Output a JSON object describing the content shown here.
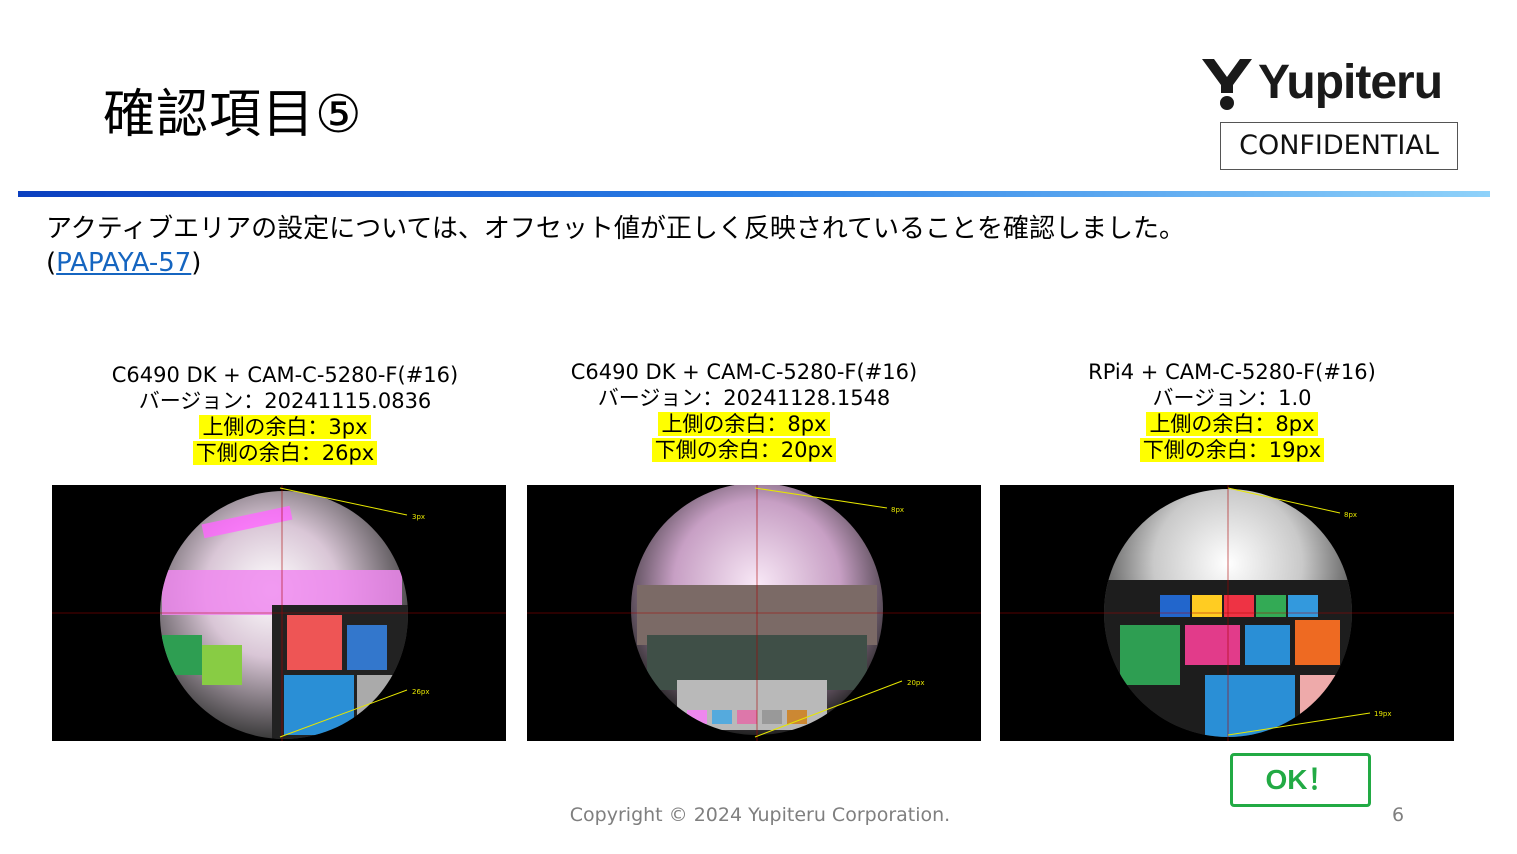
{
  "slide": {
    "title": "確認項目⑤",
    "description": "アクティブエリアの設定については、オフセット値が正しく反映されていることを確認しました。",
    "ticket_open": "(",
    "ticket": "PAPAYA-57",
    "ticket_close": ")",
    "page_number": "6"
  },
  "brand": {
    "logo_text": "Yupiteru",
    "confidential": "CONFIDENTIAL"
  },
  "panels": [
    {
      "device": "C6490 DK + CAM-C-5280-F(#16)",
      "version": "バージョン：20241115.0836",
      "top_margin": "上側の余白：3px",
      "bottom_margin": "下側の余白：26px",
      "top_label": "3px",
      "bottom_label": "26px"
    },
    {
      "device": "C6490 DK + CAM-C-5280-F(#16)",
      "version": "バージョン：20241128.1548",
      "top_margin": "上側の余白：8px",
      "bottom_margin": "下側の余白：20px",
      "top_label": "8px",
      "bottom_label": "20px"
    },
    {
      "device": "RPi4 + CAM-C-5280-F(#16)",
      "version": "バージョン：1.0",
      "top_margin": "上側の余白：8px",
      "bottom_margin": "下側の余白：19px",
      "top_label": "8px",
      "bottom_label": "19px"
    }
  ],
  "result": {
    "label": "OK！"
  },
  "footer": {
    "copyright": "Copyright © 2024 Yupiteru Corporation."
  },
  "colors": {
    "highlight": "#ffff00",
    "ok_green": "#22aa44",
    "link": "#1565c0"
  }
}
